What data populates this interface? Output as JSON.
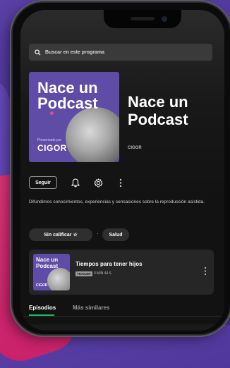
{
  "search": {
    "placeholder": "Buscar en este programa"
  },
  "podcast": {
    "cover_title": "Nace un Podcast",
    "cover_brand_small": "Presentado por",
    "cover_brand": "CIGOR",
    "title": "Nace un Podcast",
    "author": "CIGOR",
    "description": "Difundimos conocimientos, experiencias y sensaciones sobre la reproducción asistida."
  },
  "actions": {
    "follow_label": "Seguir"
  },
  "chips": {
    "rating": "Sin calificar ☆",
    "category": "Salud"
  },
  "episode": {
    "thumb_title": "Nace un Podcast",
    "thumb_brand": "CIGOR",
    "title": "Tiempos para tener hijos",
    "badge": "TRAILER",
    "meta": "3 MIN 44 S"
  },
  "tabs": [
    {
      "label": "Episodios"
    },
    {
      "label": "Más similares"
    }
  ],
  "colors": {
    "accent": "#1db954",
    "cover": "#5e4ca6",
    "background": "#121212"
  }
}
